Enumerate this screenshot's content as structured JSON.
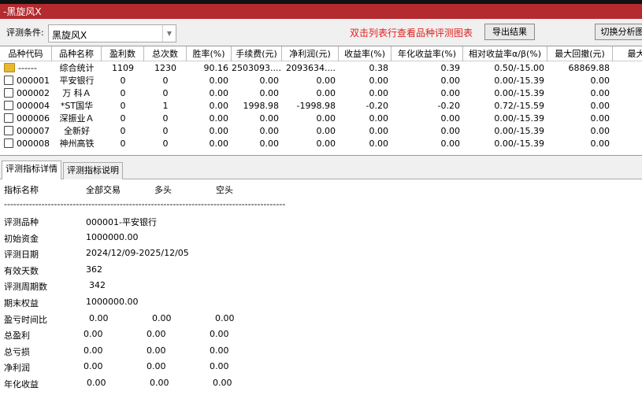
{
  "window": {
    "title": "-黑旋风X"
  },
  "toolbar": {
    "condition_label": "评测条件:",
    "condition_value": "黑旋风X",
    "hint": "双击列表行查看品种评测图表",
    "export_label": "导出结果",
    "switch_label": "切换分析图"
  },
  "table": {
    "columns": [
      "品种代码",
      "品种名称",
      "盈利数",
      "总次数",
      "胜率(%)",
      "手续费(元)",
      "净利润(元)",
      "收益率(%)",
      "年化收益率(%)",
      "相对收益率α/β(%)",
      "最大回撤(元)",
      "最大"
    ],
    "rows": [
      [
        "------",
        "综合统计",
        "1109",
        "1230",
        "90.16",
        "2503093....",
        "2093634....",
        "0.38",
        "0.39",
        "0.50/-15.00",
        "68869.88"
      ],
      [
        "000001",
        "平安银行",
        "0",
        "0",
        "0.00",
        "0.00",
        "0.00",
        "0.00",
        "0.00",
        "0.00/-15.39",
        "0.00"
      ],
      [
        "000002",
        "万 科Ａ",
        "0",
        "0",
        "0.00",
        "0.00",
        "0.00",
        "0.00",
        "0.00",
        "0.00/-15.39",
        "0.00"
      ],
      [
        "000004",
        "*ST国华",
        "0",
        "1",
        "0.00",
        "1998.98",
        "-1998.98",
        "-0.20",
        "-0.20",
        "0.72/-15.59",
        "0.00"
      ],
      [
        "000006",
        "深振业Ａ",
        "0",
        "0",
        "0.00",
        "0.00",
        "0.00",
        "0.00",
        "0.00",
        "0.00/-15.39",
        "0.00"
      ],
      [
        "000007",
        "全新好",
        "0",
        "0",
        "0.00",
        "0.00",
        "0.00",
        "0.00",
        "0.00",
        "0.00/-15.39",
        "0.00"
      ],
      [
        "000008",
        "神州高铁",
        "0",
        "0",
        "0.00",
        "0.00",
        "0.00",
        "0.00",
        "0.00",
        "0.00/-15.39",
        "0.00"
      ]
    ]
  },
  "tabs": [
    "评测指标详情",
    "评测指标说明"
  ],
  "detail": {
    "headers": [
      "指标名称",
      "全部交易",
      "多头",
      "空头"
    ],
    "separator": "------------------------------------------------------------------------------------------",
    "rows": [
      {
        "name": "评测品种",
        "values": [
          "000001-平安银行"
        ]
      },
      {
        "name": "初始资金",
        "values": [
          "1000000.00"
        ]
      },
      {
        "name": "评测日期",
        "values": [
          "2024/12/09-2025/12/05"
        ]
      },
      {
        "name": "有效天数",
        "values": [
          "362"
        ]
      },
      {
        "name": "评测周期数",
        "values": [
          "342"
        ]
      },
      {
        "name": "期末权益",
        "values": [
          "1000000.00"
        ]
      },
      {
        "name": "盈亏时间比",
        "values": [
          "0.00",
          "0.00",
          "0.00"
        ]
      },
      {
        "name": "总盈利",
        "values": [
          "0.00",
          "0.00",
          "0.00"
        ]
      },
      {
        "name": "总亏损",
        "values": [
          "0.00",
          "0.00",
          "0.00"
        ]
      },
      {
        "name": "净利润",
        "values": [
          "0.00",
          "0.00",
          "0.00"
        ]
      },
      {
        "name": "年化收益",
        "values": [
          "0.00",
          "0.00",
          "0.00"
        ]
      }
    ]
  }
}
